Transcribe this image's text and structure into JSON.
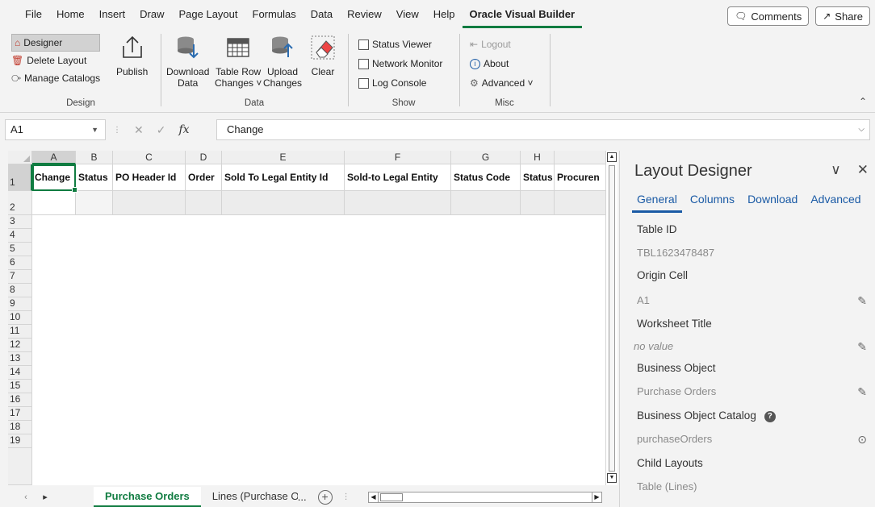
{
  "menu": {
    "items": [
      "File",
      "Home",
      "Insert",
      "Draw",
      "Page Layout",
      "Formulas",
      "Data",
      "Review",
      "View",
      "Help",
      "Oracle Visual Builder"
    ],
    "active": "Oracle Visual Builder",
    "comments_label": "Comments",
    "share_label": "Share"
  },
  "ribbon": {
    "design": {
      "designer": "Designer",
      "delete_layout": "Delete Layout",
      "manage_catalogs": "Manage Catalogs",
      "publish": "Publish",
      "group_label": "Design"
    },
    "data": {
      "download_line1": "Download",
      "download_line2": "Data",
      "table_row_line1": "Table Row",
      "table_row_line2": "Changes ˅",
      "upload_line1": "Upload",
      "upload_line2": "Changes",
      "clear": "Clear",
      "group_label": "Data"
    },
    "show": {
      "status_viewer": "Status Viewer",
      "network_monitor": "Network Monitor",
      "log_console": "Log Console",
      "group_label": "Show"
    },
    "misc": {
      "logout": "Logout",
      "about": "About",
      "advanced": "Advanced ˅",
      "group_label": "Misc"
    }
  },
  "formula_bar": {
    "name_box": "A1",
    "fx": "fx",
    "value": "Change"
  },
  "sheet": {
    "columns": [
      "A",
      "B",
      "C",
      "D",
      "E",
      "F",
      "G",
      "H"
    ],
    "headers": [
      "Change",
      "Status",
      "PO Header Id",
      "Order",
      "Sold To Legal Entity Id",
      "Sold-to Legal Entity",
      "Status Code",
      "Status",
      "Procuren"
    ],
    "rows": [
      "1",
      "2",
      "3",
      "4",
      "5",
      "6",
      "7",
      "8",
      "9",
      "10",
      "11",
      "12",
      "13",
      "14",
      "15",
      "16",
      "17",
      "18",
      "19"
    ]
  },
  "tabs": {
    "active": "Purchase Orders",
    "second": "Lines (Purchase Orders)",
    "ellipsis": "..."
  },
  "pane": {
    "title": "Layout Designer",
    "tabs": [
      "General",
      "Columns",
      "Download",
      "Advanced"
    ],
    "props": {
      "table_id_label": "Table ID",
      "table_id_value": "TBL1623478487",
      "origin_cell_label": "Origin Cell",
      "origin_cell_value": "A1",
      "worksheet_title_label": "Worksheet Title",
      "worksheet_title_value": "no value",
      "business_object_label": "Business Object",
      "business_object_value": "Purchase Orders",
      "catalog_label": "Business Object Catalog",
      "catalog_value": "purchaseOrders",
      "child_layouts_label": "Child Layouts",
      "child_layouts_value": "Table (Lines)"
    }
  },
  "colors": {
    "excel_green": "#107c41",
    "link_blue": "#1a5aa5"
  }
}
